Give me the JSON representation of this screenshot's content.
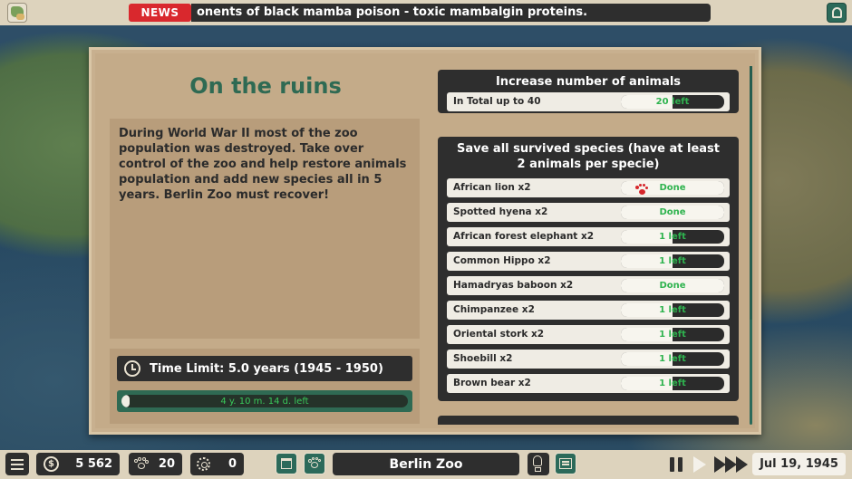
{
  "top_bar": {
    "news_label": "NEWS",
    "news_text": "onents of black mamba poison - toxic mambalgin proteins."
  },
  "panel": {
    "title": "On the ruins",
    "description": "During World War II most of the zoo population was destroyed. Take over control of the zoo and help restore animals population and add new species all in 5 years. Berlin Zoo must recover!",
    "time_limit": "Time Limit: 5.0 years (1945 - 1950)",
    "time_left": "4 y. 10 m. 14 d. left",
    "time_elapsed_fraction": 0.03
  },
  "goals": {
    "increase": {
      "title": "Increase number of animals",
      "label": "In Total up to 40",
      "status": "20 left",
      "progress": 0.5
    },
    "species": {
      "title": "Save all survived species (have at least 2 animals per specie)",
      "rows": [
        {
          "label": "African lion x2",
          "status": "Done",
          "progress": 1.0
        },
        {
          "label": "Spotted hyena x2",
          "status": "Done",
          "progress": 1.0
        },
        {
          "label": "African forest elephant x2",
          "status": "1 left",
          "progress": 0.5
        },
        {
          "label": "Common Hippo x2",
          "status": "1 left",
          "progress": 0.5
        },
        {
          "label": "Hamadryas baboon x2",
          "status": "Done",
          "progress": 1.0
        },
        {
          "label": "Chimpanzee x2",
          "status": "1 left",
          "progress": 0.5
        },
        {
          "label": "Oriental stork x2",
          "status": "1 left",
          "progress": 0.5
        },
        {
          "label": "Shoebill x2",
          "status": "1 left",
          "progress": 0.5
        },
        {
          "label": "Brown bear x2",
          "status": "1 left",
          "progress": 0.5
        }
      ]
    }
  },
  "bottom_bar": {
    "money": "5 562",
    "animals": "20",
    "staff": "0",
    "zoo_name": "Berlin Zoo",
    "date": "Jul 19, 1945"
  },
  "icons": {
    "map": "map-icon",
    "alerts": "bell-icon",
    "clock": "clock-icon",
    "paw": "paw-icon",
    "money": "coin-icon",
    "settings": "gear-icon",
    "shop": "shop-icon",
    "ideas": "bulb-icon",
    "stats": "stats-icon",
    "pause": "pause-icon",
    "play": "play-icon",
    "fast_forward": "fast-forward-icon"
  },
  "colors": {
    "accent_green": "#2f6a53",
    "news_red": "#d9282d",
    "status_green": "#2fb34f"
  }
}
